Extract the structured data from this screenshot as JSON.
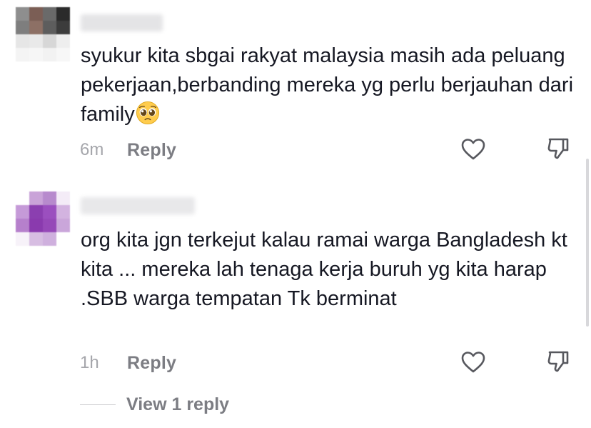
{
  "comments": [
    {
      "text": "syukur kita sbgai rakyat malaysia masih ada peluang pekerjaan,berbanding mereka yg perlu berjauhan dari family",
      "emoji": "pleading-face",
      "time": "6m",
      "reply_label": "Reply",
      "avatar_colors": [
        "#8e8e8e",
        "#7b5e55",
        "#6a6a6a",
        "#2b2b2b",
        "#7e7e7e",
        "#8d7065",
        "#5d5d5d",
        "#3c3c3c",
        "#e6e6e6",
        "#e9e9e9",
        "#d7d7d7",
        "#eeeeee",
        "#f4f4f4",
        "#f6f6f6",
        "#f2f2f2",
        "#f7f7f7"
      ],
      "username_color": "#e4e4e6"
    },
    {
      "text": "org kita jgn terkejut kalau ramai warga Bangladesh kt kita ... mereka lah tenaga kerja buruh yg kita harap .SBB warga tempatan Tk berminat",
      "time": "1h",
      "reply_label": "Reply",
      "avatar_colors": [
        "#ffffff",
        "#c9a3d8",
        "#b78acd",
        "#f4ecf7",
        "#c59ad8",
        "#8b3fb0",
        "#9b4fbf",
        "#d3b3e0",
        "#b680cc",
        "#8a3aae",
        "#9648b8",
        "#caa6da",
        "#f7f2f9",
        "#d7bde2",
        "#cfb0de",
        "#ffffff"
      ],
      "username_color": "#e8e8ea"
    }
  ],
  "view_replies_label": "View 1 reply",
  "icons": {
    "like": "heart-outline-icon",
    "dislike": "thumbs-down-outline-icon"
  }
}
